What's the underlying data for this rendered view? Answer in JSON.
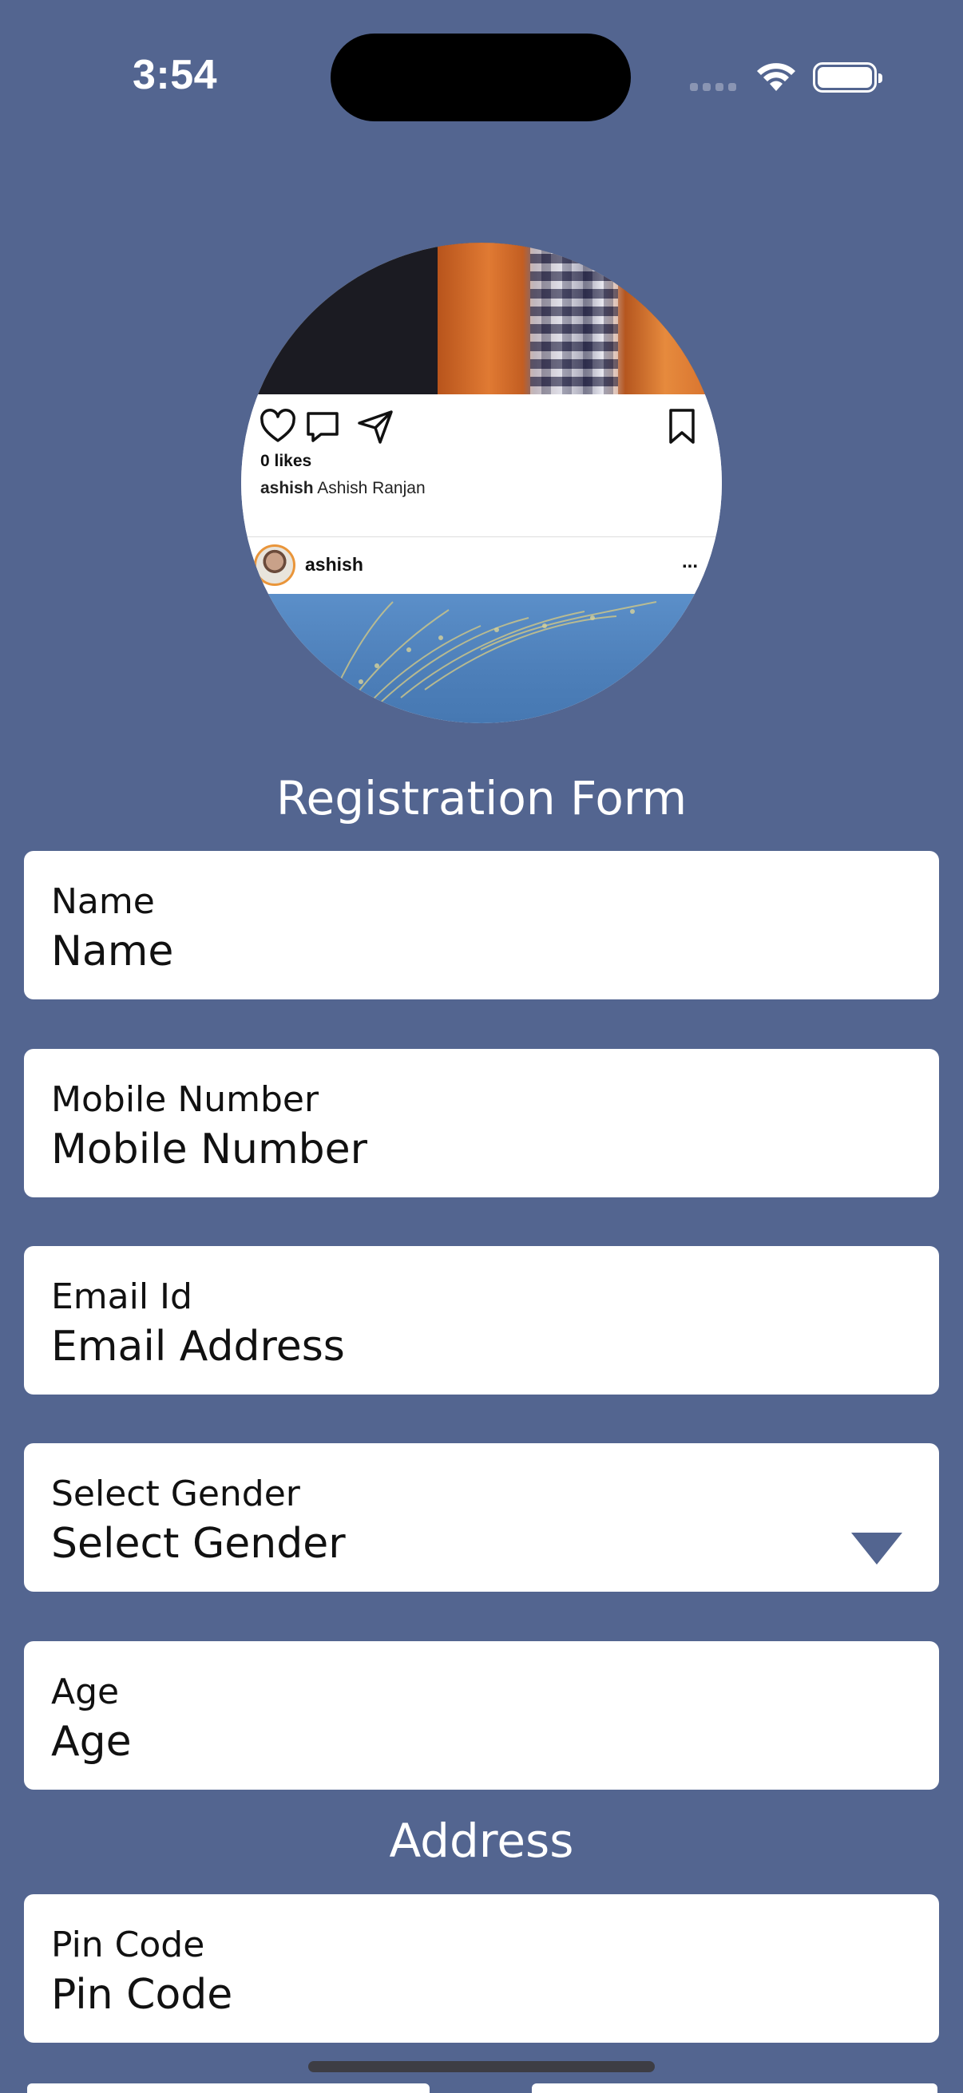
{
  "status_bar": {
    "time": "3:54"
  },
  "profile_post": {
    "likes": "0 likes",
    "caption_user": "ashish",
    "caption_text": "Ashish Ranjan",
    "username": "ashish",
    "more": "..."
  },
  "form": {
    "title": "Registration Form",
    "fields": [
      {
        "label": "Name",
        "value": "Name"
      },
      {
        "label": "Mobile Number",
        "value": "Mobile Number"
      },
      {
        "label": "Email Id",
        "value": "Email Address"
      },
      {
        "label": "Select Gender",
        "value": "Select Gender"
      },
      {
        "label": "Age",
        "value": "Age"
      }
    ]
  },
  "address": {
    "title": "Address",
    "fields": [
      {
        "label": "Pin Code",
        "value": "Pin Code"
      }
    ]
  },
  "colors": {
    "background": "#536590",
    "field_background": "#ffffff",
    "dropdown_arrow": "#536590"
  },
  "icons": [
    "heart-icon",
    "comment-icon",
    "send-icon",
    "bookmark-icon",
    "chevron-down-icon",
    "wifi-icon",
    "battery-icon"
  ]
}
